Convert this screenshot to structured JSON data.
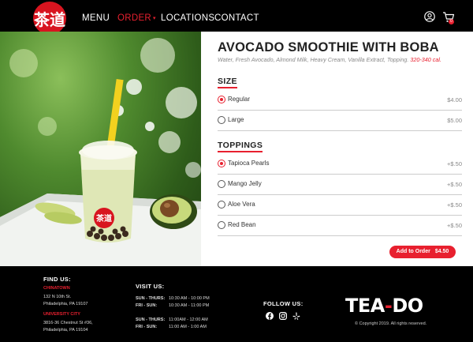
{
  "header": {
    "logo_glyph": "茶道",
    "nav": [
      {
        "label": "MENU",
        "active": false
      },
      {
        "label": "ORDER",
        "active": true,
        "caret": "▾"
      },
      {
        "label": "LOCATIONS",
        "active": false
      },
      {
        "label": "CONTACT",
        "active": false
      }
    ],
    "cart_count": "0",
    "user_icon": "user-circle-icon",
    "cart_icon": "shopping-cart-icon"
  },
  "product": {
    "title": "AVOCADO SMOOTHIE WITH BOBA",
    "ingredients": "Water, Fresh Avocado, Almond Milk, Heavy Cream, Vanilla Extract, Topping.",
    "calories": "320-340 cal.",
    "cup_logo_glyph": "茶道",
    "size_section": {
      "title": "SIZE",
      "options": [
        {
          "label": "Regular",
          "price": "$4.00",
          "selected": true
        },
        {
          "label": "Large",
          "price": "$5.00",
          "selected": false
        }
      ]
    },
    "toppings_section": {
      "title": "TOPPINGS",
      "options": [
        {
          "label": "Tapioca Pearls",
          "price": "+$.50",
          "selected": true
        },
        {
          "label": "Mango Jelly",
          "price": "+$.50",
          "selected": false
        },
        {
          "label": "Aloe Vera",
          "price": "+$.50",
          "selected": false
        },
        {
          "label": "Red Bean",
          "price": "+$.50",
          "selected": false
        }
      ]
    },
    "add_button": {
      "label": "Add to Order",
      "price": "$4.50"
    }
  },
  "footer": {
    "find_us": {
      "title": "FIND US:",
      "locations": [
        {
          "name": "CHINATOWN",
          "line1": "132 N 10th St.",
          "line2": "Philadelphia, PA 19107"
        },
        {
          "name": "UNIVERSITY CITY",
          "line1": "3816-36 Chestnut St #36,",
          "line2": "Philadelphia, PA 19104"
        }
      ]
    },
    "visit_us": {
      "title": "VISIT US:",
      "hours": [
        {
          "days": "SUN - THURS:",
          "time": "10:30 AM - 10:00 PM"
        },
        {
          "days": "FRI - SUN:",
          "time": "10:30 AM - 11:00 PM"
        },
        {
          "days": "SUN - THURS:",
          "time": "11:00AM - 12:00 AM"
        },
        {
          "days": "FRI - SUN:",
          "time": "11:00 AM - 1:00 AM"
        }
      ]
    },
    "follow_us": {
      "title": "FOLLOW US:",
      "icons": [
        "facebook-icon",
        "instagram-icon",
        "yelp-icon"
      ]
    },
    "brand": {
      "part1": "TEA",
      "dash": "-",
      "part2": "DO"
    },
    "copyright": "© Copyright 2019. All rights reserved."
  },
  "colors": {
    "accent": "#e8202f",
    "background": "#000000",
    "panel": "#ffffff"
  }
}
